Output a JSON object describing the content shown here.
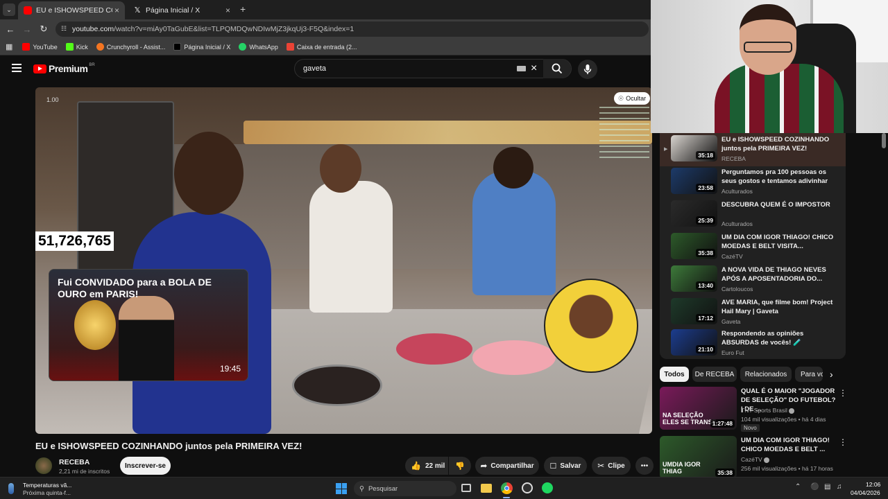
{
  "browser": {
    "tabs": [
      {
        "title": "EU e ISHOWSPEED COZINHANDO",
        "active": true
      },
      {
        "title": "Página Inicial / X",
        "active": false
      }
    ],
    "url_host": "youtube.com",
    "url_rest": "/watch?v=miAy0TaGubE&list=TLPQMDQwNDIwMjZ3jkqUj3-F5Q&index=1",
    "bookmarks": [
      "YouTube",
      "Kick",
      "Crunchyroll - Assist...",
      "Página Inicial / X",
      "WhatsApp",
      "Caixa de entrada (2..."
    ]
  },
  "masthead": {
    "logo": "Premium",
    "region": "BR",
    "search_value": "gaveta"
  },
  "player": {
    "speed": "1.00",
    "hide_label": "Ocultar",
    "view_count": "51,726,765",
    "card_title": "Fui CONVIDADO para a BOLA DE OURO em PARIS!",
    "card_duration": "19:45"
  },
  "video": {
    "title": "EU e ISHOWSPEED COZINHANDO juntos pela PRIMEIRA VEZ!",
    "channel": "RECEBA",
    "subscribers": "2,21 mi de inscritos",
    "subscribe_label": "Inscrever-se",
    "likes": "22 mil",
    "share_label": "Compartilhar",
    "save_label": "Salvar",
    "clip_label": "Clipe"
  },
  "playlist": [
    {
      "title": "EU e ISHOWSPEED COZINHANDO juntos pela PRIMEIRA VEZ!",
      "channel": "RECEBA",
      "duration": "35:18",
      "color": "#d9d4cf"
    },
    {
      "title": "Perguntamos pra 100 pessoas os seus gostos e tentamos adivinhar",
      "channel": "Aculturados",
      "duration": "23:58",
      "color": "#1d3b6a"
    },
    {
      "title": "DESCUBRA QUEM É O IMPOSTOR",
      "channel": "Aculturados",
      "duration": "25:39",
      "color": "#2b2b2b"
    },
    {
      "title": "UM DIA COM IGOR THIAGO! CHICO MOEDAS E BELT VISITA...",
      "channel": "CazéTV",
      "duration": "35:38",
      "color": "#2d5a2a"
    },
    {
      "title": "A NOVA VIDA DE THIAGO NEVES APÓS A APOSENTADORIA DO...",
      "channel": "Cartoloucos",
      "duration": "13:40",
      "color": "#3d7a3a"
    },
    {
      "title": "AVE MARIA, que filme bom! Project Hail Mary | Gaveta",
      "channel": "Gaveta",
      "duration": "17:12",
      "color": "#1e3a2a"
    },
    {
      "title": "Respondendo as opiniões ABSURDAS de vocês! 🧪",
      "channel": "Euro Fut",
      "duration": "21:10",
      "color": "#1c3d8f"
    }
  ],
  "filter_chips": [
    "Todos",
    "De RECEBA",
    "Relacionados",
    "Para vo"
  ],
  "recommendations": [
    {
      "title": "QUAL É O MAIOR \"JOGADOR DE SELEÇÃO\" DO FUTEBOL? | DE ...",
      "channel": "TNT Sports Brasil",
      "meta": "104 mil visualizações • há 4 dias",
      "badge": "Novo",
      "duration": "1:27:48",
      "overlay": "NA SELEÇÃO ELES SE TRANSF",
      "color": "#7a1a5a"
    },
    {
      "title": "UM DIA COM IGOR THIAGO! CHICO MOEDAS E BELT ...",
      "channel": "CazéTV",
      "meta": "256 mil visualizações • há 17 horas",
      "badge": "",
      "duration": "35:38",
      "overlay": "UMDIA IGOR THIAG",
      "color": "#2d5a2a"
    }
  ],
  "taskbar": {
    "weather_title": "Temperaturas vã...",
    "weather_sub": "Próxima quinta-f...",
    "search_placeholder": "Pesquisar",
    "time": "12:06",
    "date": "04/04/2026"
  },
  "colors": {
    "accent": "#ff0000",
    "bg": "#0f0f0f",
    "chip_active": "#f1f1f1"
  }
}
